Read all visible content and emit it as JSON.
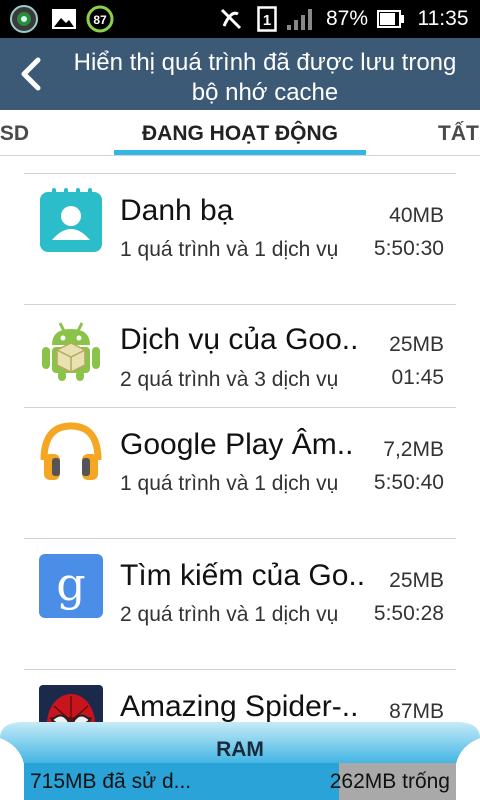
{
  "status_bar": {
    "battery_percent": "87%",
    "time": "11:35",
    "sim_label": "1",
    "notification_badge": "87",
    "icons": [
      "app-icon",
      "image-icon",
      "battery-saver-icon",
      "silent-icon",
      "sim-icon",
      "signal-icon",
      "battery-icon"
    ]
  },
  "action_bar": {
    "title": "Hiển thị quá trình đã được lưu trong bộ nhớ cache"
  },
  "tabs": [
    {
      "label": "Ẻ SD"
    },
    {
      "label": "ĐANG HOẠT ĐỘNG",
      "active": true
    },
    {
      "label": "TẤT"
    }
  ],
  "apps": [
    {
      "name": "Danh bạ",
      "size": "40MB",
      "desc": "1 quá trình và 1 dịch vụ",
      "time": "5:50:30",
      "icon": "contacts-icon"
    },
    {
      "name": "Dịch vụ của Goo..",
      "size": "25MB",
      "desc": "2 quá trình và 3 dịch vụ",
      "time": "01:45",
      "icon": "android-icon"
    },
    {
      "name": "Google Play Âm..",
      "size": "7,2MB",
      "desc": "1 quá trình và 1 dịch vụ",
      "time": "5:50:40",
      "icon": "headphones-icon"
    },
    {
      "name": "Tìm kiếm của Go..",
      "size": "25MB",
      "desc": "2 quá trình và 1 dịch vụ",
      "time": "5:50:28",
      "icon": "google-search-icon"
    },
    {
      "name": "Amazing Spider-..",
      "size": "87MB",
      "desc": "",
      "time": "",
      "icon": "spiderman-icon"
    }
  ],
  "ram": {
    "label": "RAM",
    "used_text": "715MB đã sử d...",
    "free_text": "262MB trống",
    "used_fraction": 0.73
  },
  "colors": {
    "action_bar": "#3c5a76",
    "accent": "#33b5e5",
    "ram_used": "#2aa3d9",
    "ram_free": "#a9a9a9"
  }
}
